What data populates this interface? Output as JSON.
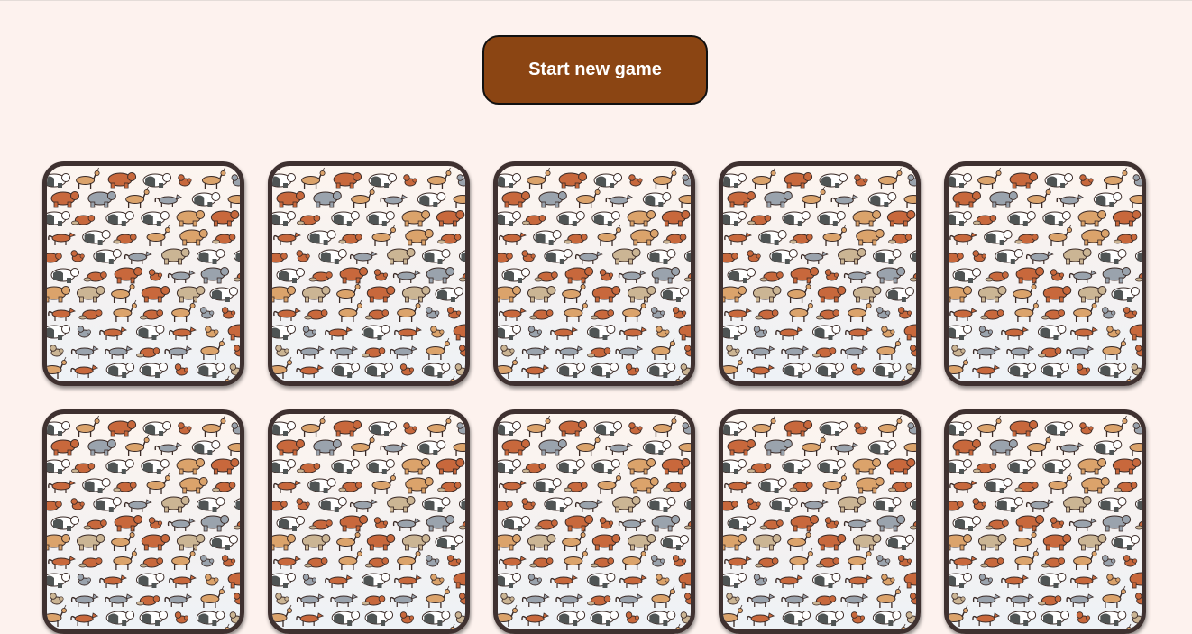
{
  "toolbar": {
    "start_label": "Start new game"
  },
  "colors": {
    "page_background": "#fdf2ee",
    "button_background": "#8b4513",
    "button_text": "#ffffff",
    "card_border": "#3f3130",
    "animal_orange": "#c8683c",
    "animal_tan": "#dba36b",
    "animal_sand": "#cbb594",
    "animal_gray": "#9aa3ad",
    "animal_dark": "#4f5454",
    "animal_white": "#ffffff"
  },
  "board": {
    "rows": 2,
    "columns": 5,
    "cards": [
      {
        "state": "face-down",
        "back": "animal-pattern-icon"
      },
      {
        "state": "face-down",
        "back": "animal-pattern-icon"
      },
      {
        "state": "face-down",
        "back": "animal-pattern-icon"
      },
      {
        "state": "face-down",
        "back": "animal-pattern-icon"
      },
      {
        "state": "face-down",
        "back": "animal-pattern-icon"
      },
      {
        "state": "face-down",
        "back": "animal-pattern-icon"
      },
      {
        "state": "face-down",
        "back": "animal-pattern-icon"
      },
      {
        "state": "face-down",
        "back": "animal-pattern-icon"
      },
      {
        "state": "face-down",
        "back": "animal-pattern-icon"
      },
      {
        "state": "face-down",
        "back": "animal-pattern-icon"
      }
    ]
  }
}
